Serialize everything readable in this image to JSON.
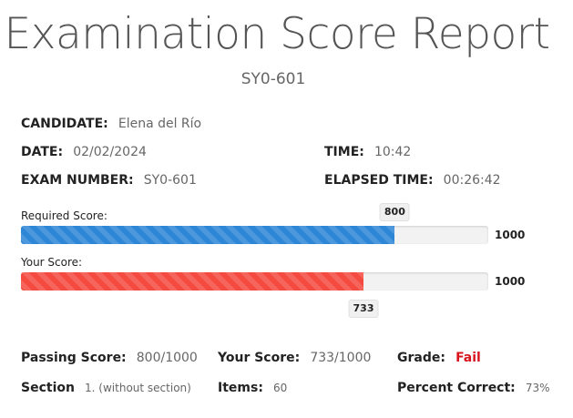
{
  "report": {
    "title": "Examination Score Report",
    "subtitle": "SY0-601"
  },
  "details": {
    "candidate_label": "CANDIDATE:",
    "candidate_value": "Elena del Río",
    "date_label": "DATE:",
    "date_value": "02/02/2024",
    "time_label": "TIME:",
    "time_value": "10:42",
    "exam_number_label": "EXAM NUMBER:",
    "exam_number_value": "SY0-601",
    "elapsed_label": "ELAPSED TIME:",
    "elapsed_value": "00:26:42"
  },
  "scores": {
    "required": {
      "label": "Required Score:",
      "value": 800,
      "value_text": "800",
      "max": 1000,
      "max_text": "1000",
      "color": "#2e86d6"
    },
    "yours": {
      "label": "Your Score:",
      "value": 733,
      "value_text": "733",
      "max": 1000,
      "max_text": "1000",
      "color": "#f44a3f"
    }
  },
  "summary": {
    "passing_label": "Passing Score:",
    "passing_value": "800/1000",
    "your_label": "Your Score:",
    "your_value": "733/1000",
    "grade_label": "Grade:",
    "grade_value": "Fail",
    "grade_color": "#d8141c",
    "section_label": "Section",
    "section_value": "1. (without section)",
    "items_label": "Items:",
    "items_value": "60",
    "percent_label": "Percent Correct:",
    "percent_value": "73%"
  }
}
